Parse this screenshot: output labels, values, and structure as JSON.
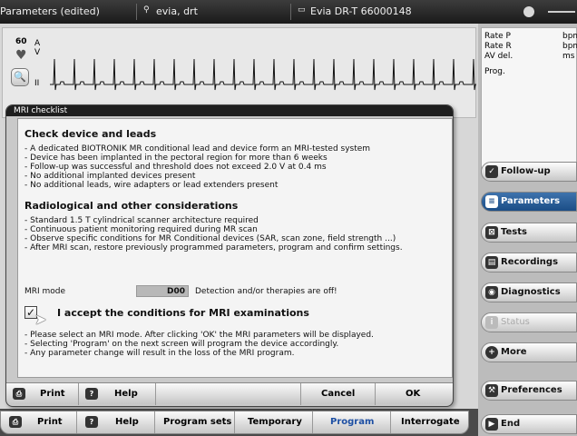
{
  "titlebar": {
    "title": "Parameters (edited)",
    "patient": "evia, drt",
    "device": "Evia DR-T 66000148"
  },
  "ecg": {
    "rate": "60",
    "channel_top": "A",
    "channel_bottom": "V",
    "lead": "II"
  },
  "status_panel": {
    "rows": [
      {
        "label": "Rate P",
        "unit": "bpm"
      },
      {
        "label": "Rate R",
        "unit": "bpm"
      },
      {
        "label": "AV del.",
        "unit": "ms"
      }
    ],
    "prog_label": "Prog."
  },
  "nav": {
    "items": [
      {
        "label": "Follow-up",
        "icon": "follow-up-icon",
        "state": "normal"
      },
      {
        "label": "Parameters",
        "icon": "parameters-icon",
        "state": "active"
      },
      {
        "label": "Tests",
        "icon": "tests-icon",
        "state": "normal"
      },
      {
        "label": "Recordings",
        "icon": "recordings-icon",
        "state": "normal"
      },
      {
        "label": "Diagnostics",
        "icon": "diagnostics-icon",
        "state": "normal"
      },
      {
        "label": "Status",
        "icon": "status-icon",
        "state": "disabled"
      },
      {
        "label": "More",
        "icon": "plus-icon",
        "state": "normal"
      },
      {
        "label": "Preferences",
        "icon": "wrench-icon",
        "state": "normal"
      },
      {
        "label": "End",
        "icon": "end-icon",
        "state": "normal"
      }
    ]
  },
  "bottombar": {
    "print": "Print",
    "help": "Help",
    "program_sets": "Program sets",
    "temporary": "Temporary",
    "program": "Program",
    "interrogate": "Interrogate"
  },
  "dialog": {
    "title": "MRI checklist",
    "section1_title": "Check device and leads",
    "section1_lines": [
      "- A dedicated BIOTRONIK MR conditional lead and device form an MRI-tested system",
      "- Device has been implanted in the pectoral region for more than 6 weeks",
      "- Follow-up was successful and threshold does not exceed 2.0 V at 0.4 ms",
      "- No additional implanted devices present",
      "- No additional leads, wire adapters or lead extenders present"
    ],
    "section2_title": "Radiological and other considerations",
    "section2_lines": [
      "- Standard 1.5 T cylindrical scanner architecture required",
      "- Continuous patient monitoring required during MR scan",
      "- Observe specific conditions for MR Conditional devices (SAR, scan zone, field strength ...)",
      "- After MRI scan, restore previously programmed parameters, program and confirm settings."
    ],
    "mri_mode_label": "MRI mode",
    "mri_mode_value": "D00",
    "mri_mode_note": "Detection and/or therapies are off!",
    "accept_checked": true,
    "accept_label": "I accept the conditions for MRI examinations",
    "notes": [
      "- Please select an MRI mode. After clicking 'OK' the MRI parameters will be displayed.",
      "- Selecting 'Program' on the next screen will program the device accordingly.",
      "- Any parameter change will result in the loss of the MRI program."
    ],
    "buttons": {
      "print": "Print",
      "help": "Help",
      "cancel": "Cancel",
      "ok": "OK"
    }
  },
  "colors": {
    "active_nav": "#1b4d86",
    "program_text": "#1d4fa3",
    "titlebar": "#1a1a1a"
  }
}
